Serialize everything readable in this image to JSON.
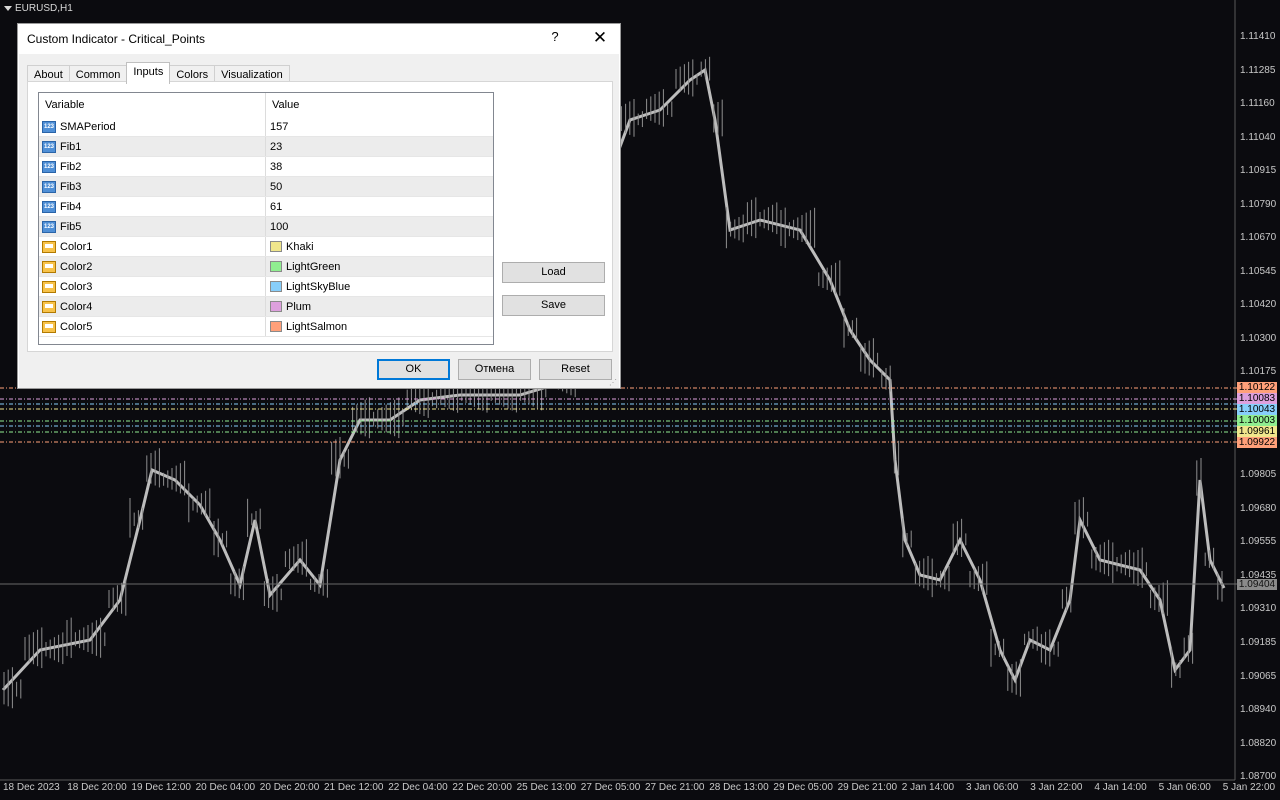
{
  "chart": {
    "symbol_label": "EURUSD,H1",
    "background": "#0b0b0f",
    "price_axis": [
      "1.11410",
      "1.11285",
      "1.11160",
      "1.11040",
      "1.10915",
      "1.10790",
      "1.10670",
      "1.10545",
      "1.10420",
      "1.10300",
      "1.10175",
      "1.09805",
      "1.09680",
      "1.09555",
      "1.09435",
      "1.09310",
      "1.09185",
      "1.09065",
      "1.08940",
      "1.08820",
      "1.08700"
    ],
    "current_price": "1.09404",
    "level_tags": [
      {
        "text": "1.10122",
        "color": "#FFA07A"
      },
      {
        "text": "1.10083",
        "color": "#DDA0DD"
      },
      {
        "text": "1.10043",
        "color": "#87CEFA"
      },
      {
        "text": "1.10003",
        "color": "#90EE90"
      },
      {
        "text": "1.09961",
        "color": "#F0E68C"
      },
      {
        "text": "1.09922",
        "color": "#FFA07A"
      }
    ],
    "date_axis": [
      "18 Dec 2023",
      "18 Dec 20:00",
      "19 Dec 12:00",
      "20 Dec 04:00",
      "20 Dec 20:00",
      "21 Dec 12:00",
      "22 Dec 04:00",
      "22 Dec 20:00",
      "25 Dec 13:00",
      "27 Dec 05:00",
      "27 Dec 21:00",
      "28 Dec 13:00",
      "29 Dec 05:00",
      "29 Dec 21:00",
      "2 Jan 14:00",
      "3 Jan 06:00",
      "3 Jan 22:00",
      "4 Jan 14:00",
      "5 Jan 06:00",
      "5 Jan 22:00"
    ]
  },
  "dialog": {
    "title": "Custom Indicator - Critical_Points",
    "help": "?",
    "close": "✕",
    "tabs": [
      "About",
      "Common",
      "Inputs",
      "Colors",
      "Visualization"
    ],
    "active_tab": "Inputs",
    "columns": {
      "variable": "Variable",
      "value": "Value"
    },
    "inputs": [
      {
        "name": "SMAPeriod",
        "value": "157",
        "icon": "numeric-icon"
      },
      {
        "name": "Fib1",
        "value": "23",
        "icon": "numeric-icon"
      },
      {
        "name": "Fib2",
        "value": "38",
        "icon": "numeric-icon"
      },
      {
        "name": "Fib3",
        "value": "50",
        "icon": "numeric-icon"
      },
      {
        "name": "Fib4",
        "value": "61",
        "icon": "numeric-icon"
      },
      {
        "name": "Fib5",
        "value": "100",
        "icon": "numeric-icon"
      },
      {
        "name": "Color1",
        "value": "Khaki",
        "icon": "color-icon",
        "swatch": "#F0E68C"
      },
      {
        "name": "Color2",
        "value": "LightGreen",
        "icon": "color-icon",
        "swatch": "#90EE90"
      },
      {
        "name": "Color3",
        "value": "LightSkyBlue",
        "icon": "color-icon",
        "swatch": "#87CEFA"
      },
      {
        "name": "Color4",
        "value": "Plum",
        "icon": "color-icon",
        "swatch": "#DDA0DD"
      },
      {
        "name": "Color5",
        "value": "LightSalmon",
        "icon": "color-icon",
        "swatch": "#FFA07A"
      }
    ],
    "load_label": "Load",
    "save_label": "Save",
    "ok_label": "OK",
    "cancel_label": "Отмена",
    "reset_label": "Reset"
  }
}
